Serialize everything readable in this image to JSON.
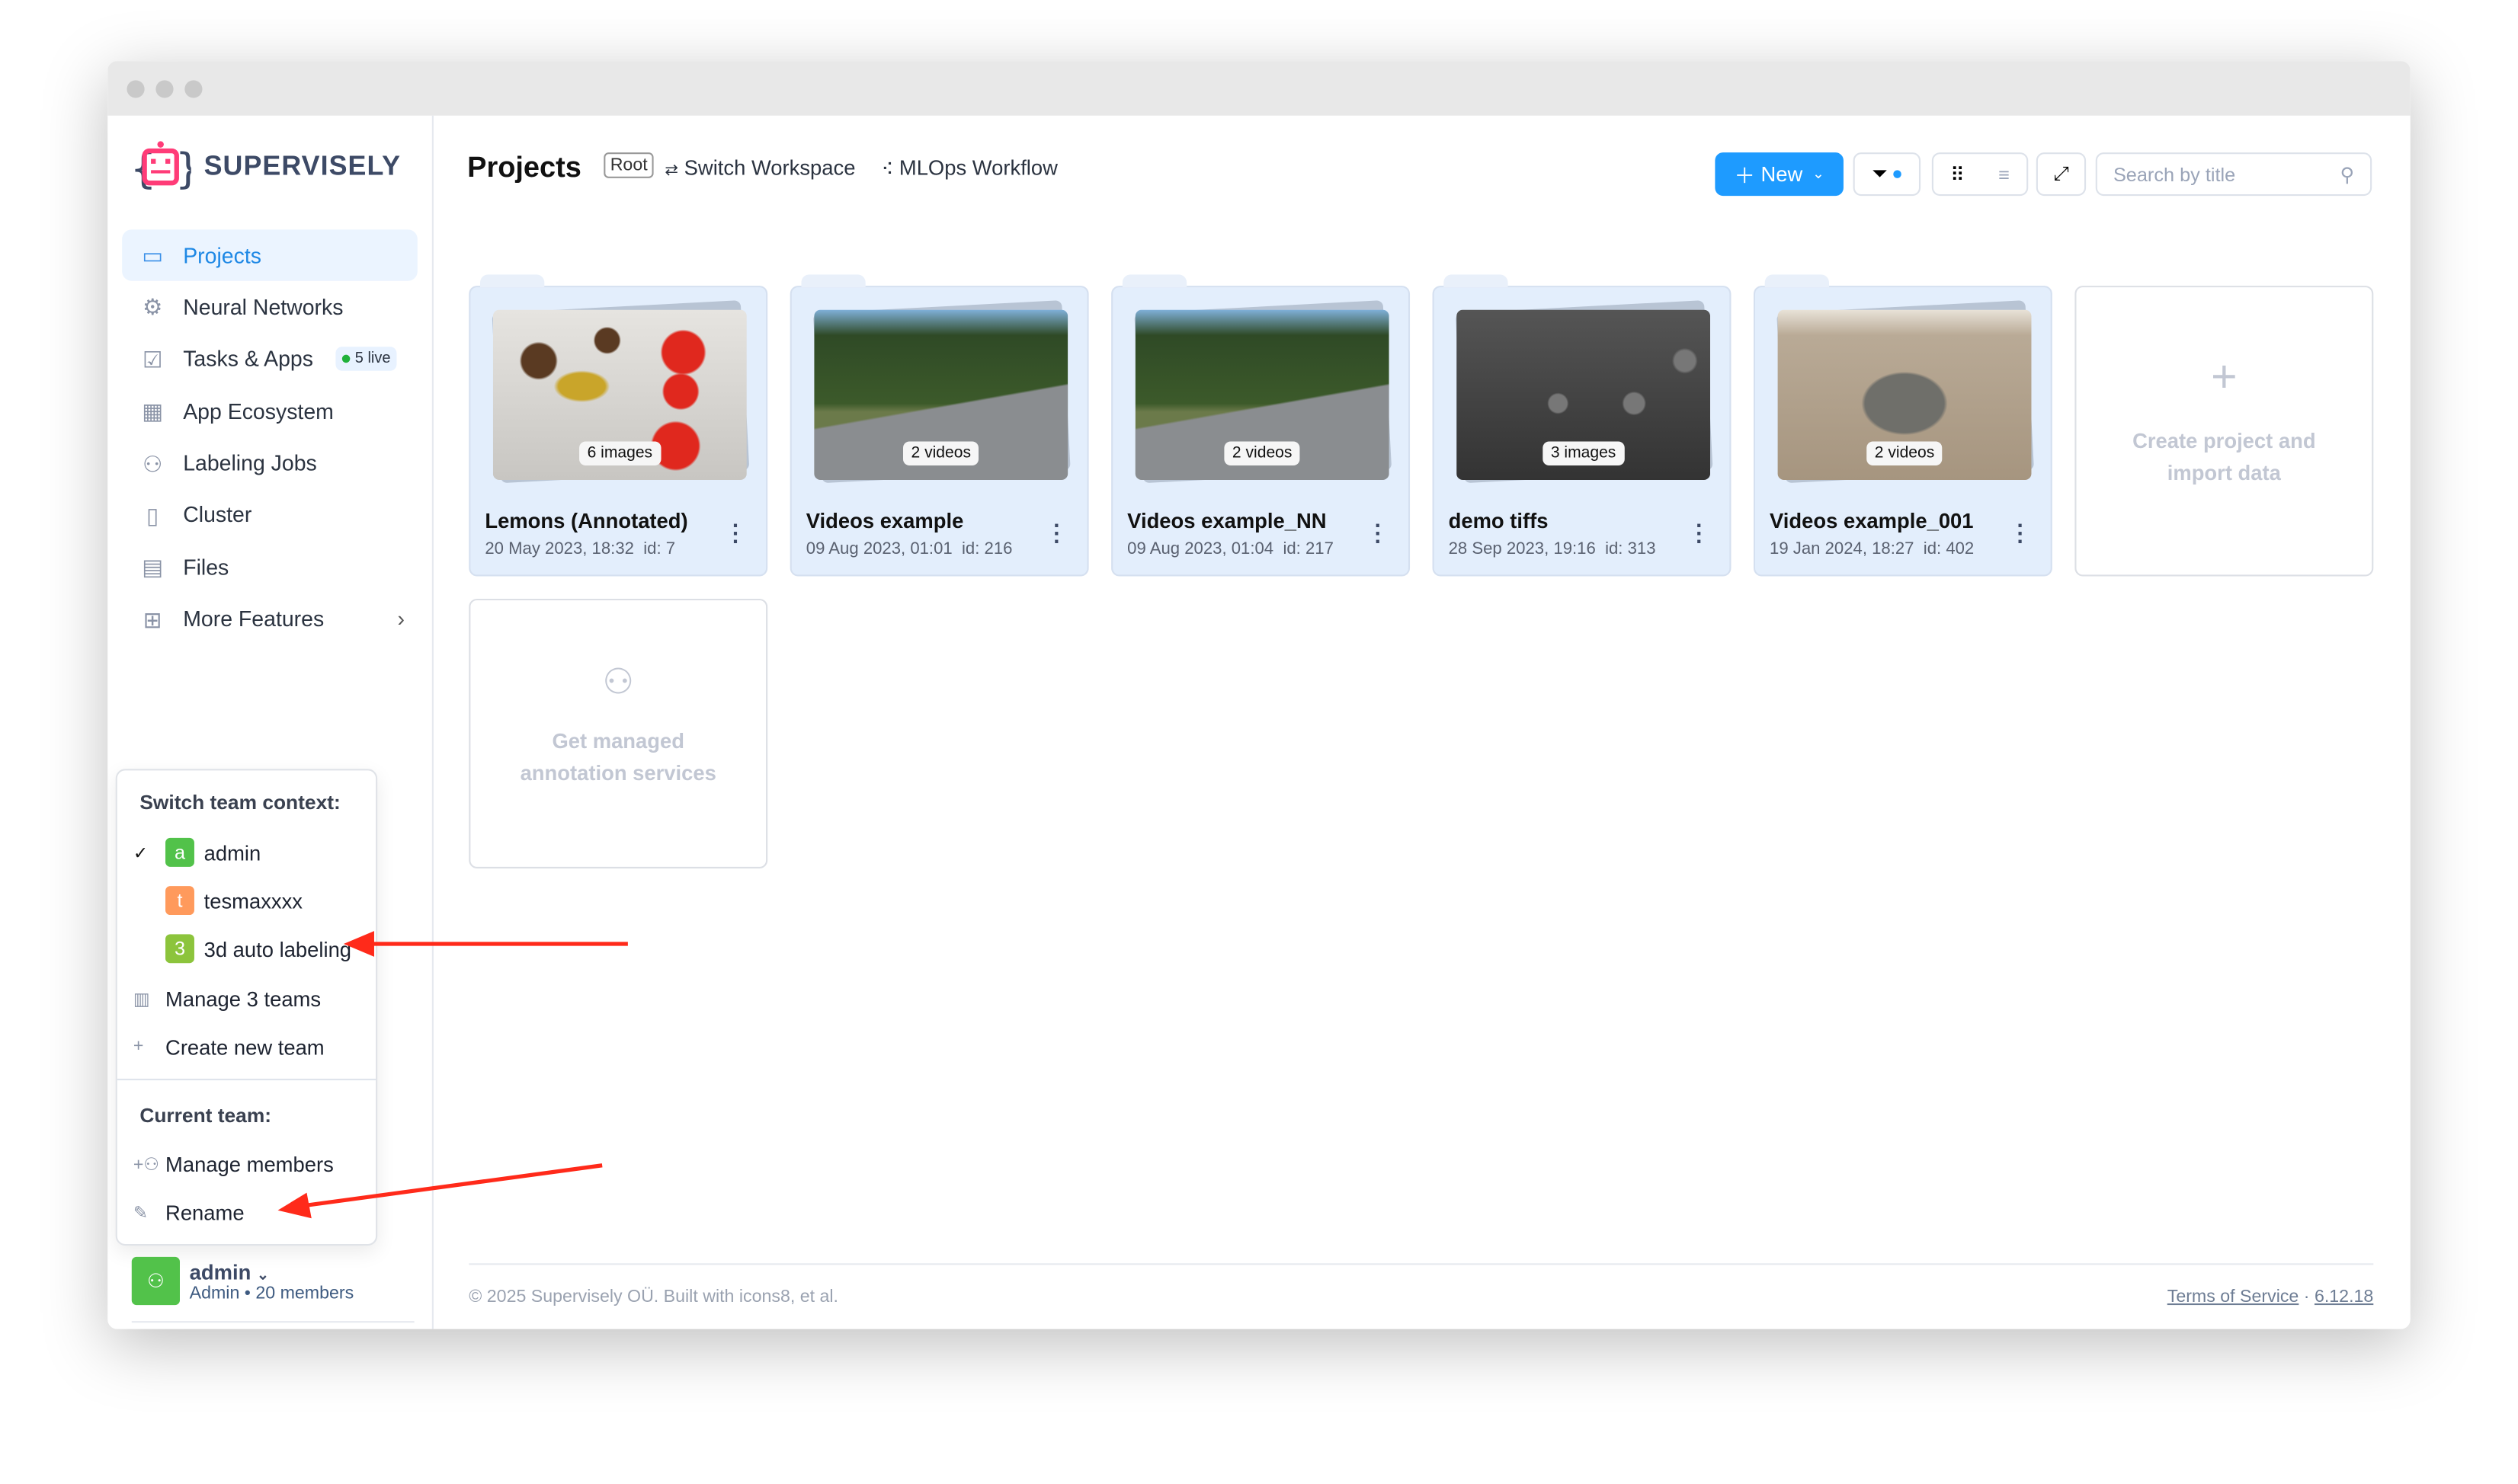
{
  "app": {
    "logo_text": "SUPERVISELY"
  },
  "sidebar": {
    "items": [
      {
        "label": "Projects",
        "icon": "folder-icon",
        "active": true
      },
      {
        "label": "Neural Networks",
        "icon": "brain-icon"
      },
      {
        "label": "Tasks & Apps",
        "icon": "clipboard-icon",
        "badge": "5 live"
      },
      {
        "label": "App Ecosystem",
        "icon": "apps-icon"
      },
      {
        "label": "Labeling Jobs",
        "icon": "labeling-icon"
      },
      {
        "label": "Cluster",
        "icon": "cluster-icon"
      },
      {
        "label": "Files",
        "icon": "file-icon"
      },
      {
        "label": "More Features",
        "icon": "grid-icon"
      }
    ]
  },
  "team_menu": {
    "switch_header": "Switch team context:",
    "teams": [
      {
        "letter": "a",
        "name": "admin",
        "color": "#52c24a",
        "selected": true
      },
      {
        "letter": "t",
        "name": "tesmaxxxx",
        "color": "#ff9a5c"
      },
      {
        "letter": "3",
        "name": "3d auto labeling",
        "color": "#8cc43c"
      }
    ],
    "manage_teams": "Manage 3 teams",
    "create_team": "Create new team",
    "current_header": "Current team:",
    "manage_members": "Manage members",
    "rename": "Rename"
  },
  "current_team": {
    "name": "admin",
    "role": "Admin",
    "members": "20 members"
  },
  "user": {
    "letter": "t",
    "name": "tesmaxxxx"
  },
  "header": {
    "title": "Projects",
    "root": "Root",
    "switch_workspace": "Switch Workspace",
    "mlops": "MLOps Workflow",
    "new_label": "New",
    "search_placeholder": "Search by title"
  },
  "projects": [
    {
      "name": "Lemons (Annotated)",
      "date": "20 May 2023, 18:32",
      "id": "id: 7",
      "count": "6 images"
    },
    {
      "name": "Videos example",
      "date": "09 Aug 2023, 01:01",
      "id": "id: 216",
      "count": "2 videos"
    },
    {
      "name": "Videos example_NN",
      "date": "09 Aug 2023, 01:04",
      "id": "id: 217",
      "count": "2 videos"
    },
    {
      "name": "demo tiffs",
      "date": "28 Sep 2023, 19:16",
      "id": "id: 313",
      "count": "3 images"
    },
    {
      "name": "Videos example_001",
      "date": "19 Jan 2024, 18:27",
      "id": "id: 402",
      "count": "2 videos"
    }
  ],
  "create_card": "Create project and import data",
  "managed_card": "Get managed annotation services",
  "footer": {
    "copyright": "© 2025 Supervisely OÜ. Built with icons8, et al.",
    "terms": "Terms of Service",
    "version": "6.12.18"
  },
  "colors": {
    "accent": "#1e9bff",
    "annotation_arrow": "#ff2a1a"
  }
}
